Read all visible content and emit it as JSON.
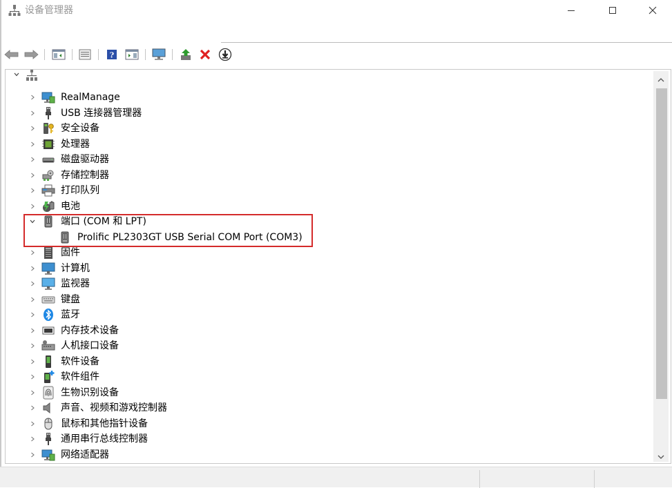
{
  "window": {
    "title": "设备管理器",
    "controls": {
      "minimize": "—",
      "maximize": "☐",
      "close": "✕"
    }
  },
  "toolbar": {
    "buttons": [
      "back-icon",
      "forward-icon",
      "show-hide-console-tree-icon",
      "properties-icon",
      "help-icon",
      "show-action-pane-icon",
      "monitor-icon",
      "update-driver-icon",
      "uninstall-icon",
      "download-icon"
    ]
  },
  "tree": {
    "root_icon": "computer-tree-icon",
    "items": [
      {
        "label": "RealManage",
        "icon": "network-monitor-icon",
        "expanded": false
      },
      {
        "label": "USB 连接器管理器",
        "icon": "usb-plug-icon",
        "expanded": false
      },
      {
        "label": "安全设备",
        "icon": "security-key-icon",
        "expanded": false
      },
      {
        "label": "处理器",
        "icon": "processor-chip-icon",
        "expanded": false
      },
      {
        "label": "磁盘驱动器",
        "icon": "disk-drive-icon",
        "expanded": false
      },
      {
        "label": "存储控制器",
        "icon": "storage-controller-icon",
        "expanded": false
      },
      {
        "label": "打印队列",
        "icon": "printer-icon",
        "expanded": false
      },
      {
        "label": "电池",
        "icon": "battery-icon",
        "expanded": false
      },
      {
        "label": "端口 (COM 和 LPT)",
        "icon": "port-icon",
        "expanded": true,
        "children": [
          {
            "label": "Prolific PL2303GT USB Serial COM Port (COM3)",
            "icon": "port-icon"
          }
        ]
      },
      {
        "label": "固件",
        "icon": "firmware-icon",
        "expanded": false
      },
      {
        "label": "计算机",
        "icon": "computer-icon",
        "expanded": false
      },
      {
        "label": "监视器",
        "icon": "monitor-icon",
        "expanded": false
      },
      {
        "label": "键盘",
        "icon": "keyboard-icon",
        "expanded": false
      },
      {
        "label": "蓝牙",
        "icon": "bluetooth-icon",
        "expanded": false
      },
      {
        "label": "内存技术设备",
        "icon": "memory-device-icon",
        "expanded": false
      },
      {
        "label": "人机接口设备",
        "icon": "hid-icon",
        "expanded": false
      },
      {
        "label": "软件设备",
        "icon": "software-device-icon",
        "expanded": false
      },
      {
        "label": "软件组件",
        "icon": "software-component-icon",
        "expanded": false
      },
      {
        "label": "生物识别设备",
        "icon": "fingerprint-icon",
        "expanded": false
      },
      {
        "label": "声音、视频和游戏控制器",
        "icon": "speaker-icon",
        "expanded": false
      },
      {
        "label": "鼠标和其他指针设备",
        "icon": "mouse-icon",
        "expanded": false
      },
      {
        "label": "通用串行总线控制器",
        "icon": "usb-plug-icon",
        "expanded": false
      },
      {
        "label": "网络适配器",
        "icon": "network-monitor-icon",
        "expanded": false
      }
    ]
  },
  "colors": {
    "highlight_border": "#d42a2a",
    "accent_blue": "#1e88e5",
    "green_arrow": "#2e9b2e",
    "red_x": "#e02020"
  }
}
